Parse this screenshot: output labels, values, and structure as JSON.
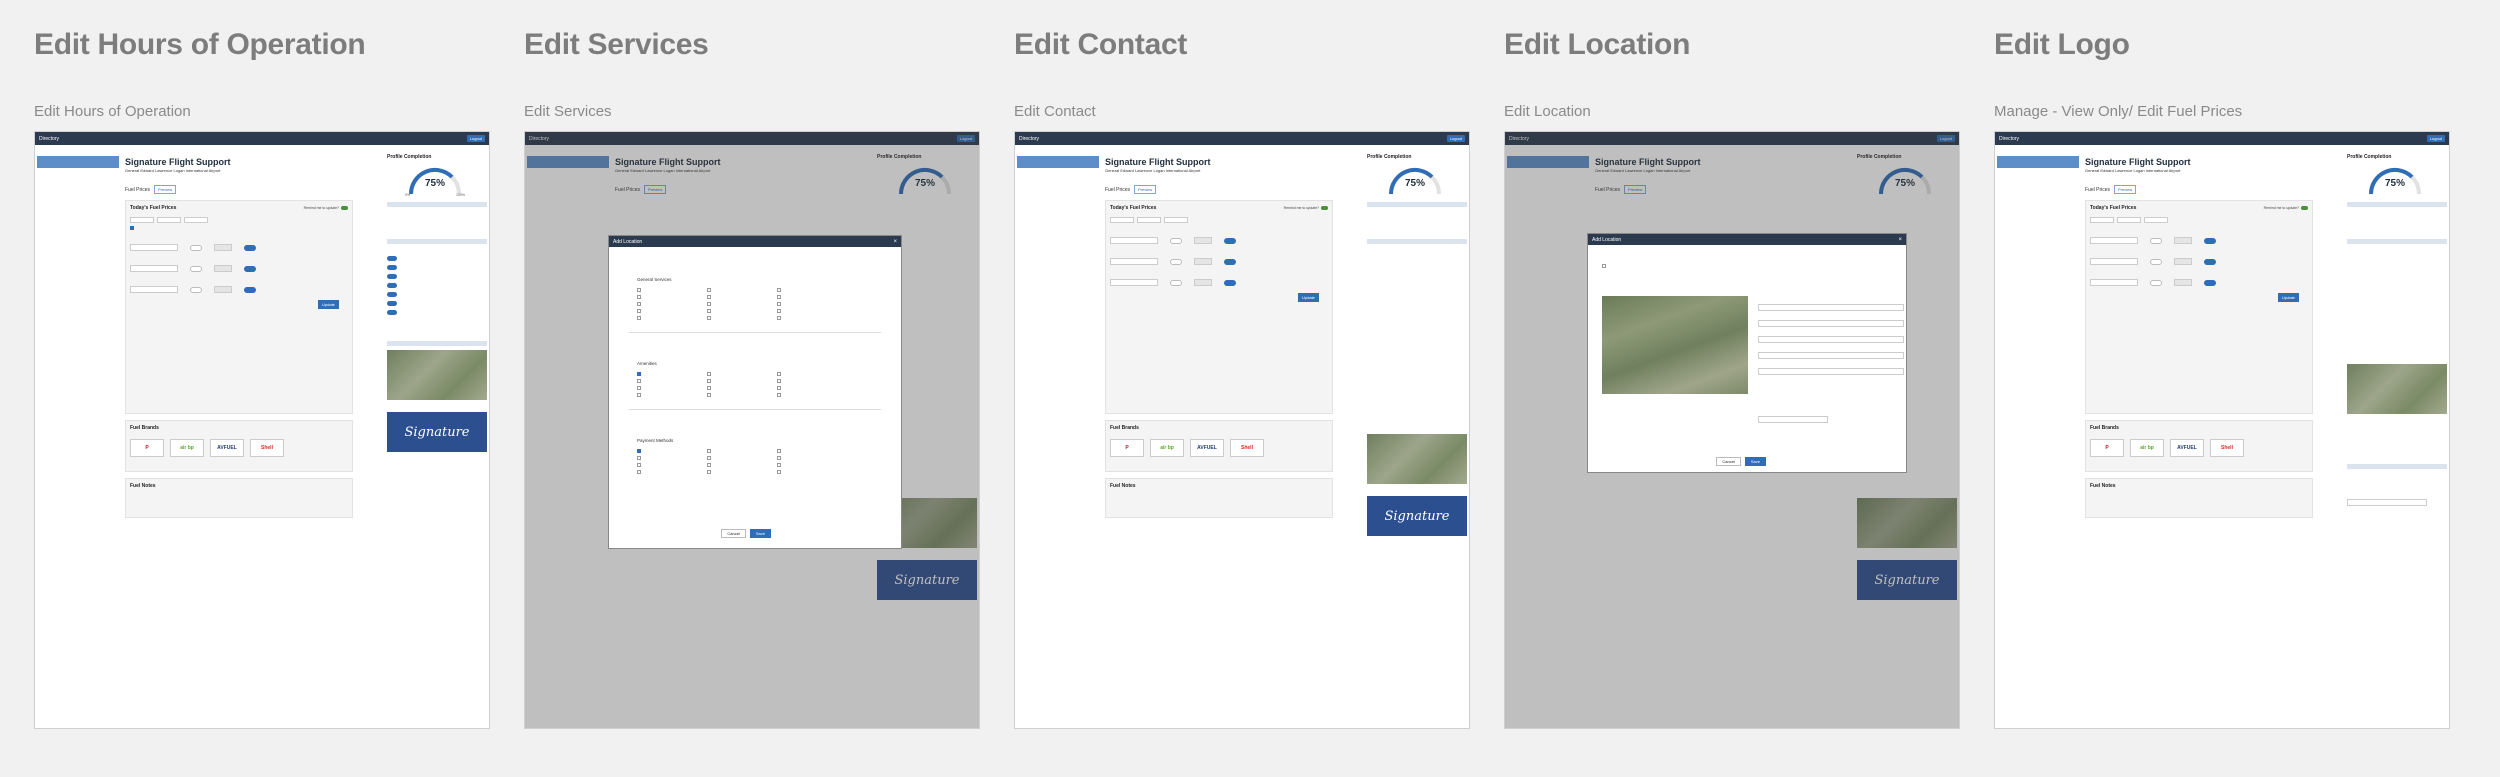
{
  "columns": [
    {
      "title": "Edit Hours of Operation",
      "subtitle": "Edit Hours of Operation",
      "variant": "hours"
    },
    {
      "title": "Edit Services",
      "subtitle": "Edit Services",
      "variant": "services"
    },
    {
      "title": "Edit Contact",
      "subtitle": "Edit Contact",
      "variant": "contact"
    },
    {
      "title": "Edit Location",
      "subtitle": "Edit Location",
      "variant": "location"
    },
    {
      "title": "Edit Logo",
      "subtitle": "Manage - View Only/ Edit Fuel Prices",
      "variant": "logo"
    }
  ],
  "app": {
    "brand": "Directory",
    "login": "Logout",
    "company": "Signature Flight Support",
    "company_sub": "General Edward Lawrence Logan International Airport",
    "tab_fuel": "Fuel Prices",
    "tab_preview": "Preview",
    "fuel_card_title": "Today's Fuel Prices",
    "fuel_card_right": "Remind me to update?",
    "update_btn": "Update",
    "brands_title": "Fuel Brands",
    "notes_title": "Fuel Notes",
    "profile_title": "Profile Completion",
    "profile_pct": "75%",
    "profile_min": "0%",
    "profile_max": "100%",
    "logo_text": "Signature",
    "brand_logos": [
      "P",
      "air bp",
      "AVFUEL",
      "Shell"
    ],
    "accent": "#2f6db7",
    "header_bg": "#2b3a4f"
  },
  "modal_services": {
    "title": "Add Location",
    "general": "General Services",
    "amenities": "Amenities",
    "payment": "Payment Methods",
    "cancel": "Cancel",
    "save": "Save"
  },
  "modal_location": {
    "title": "Add Location",
    "cancel": "Cancel",
    "save": "Save"
  }
}
